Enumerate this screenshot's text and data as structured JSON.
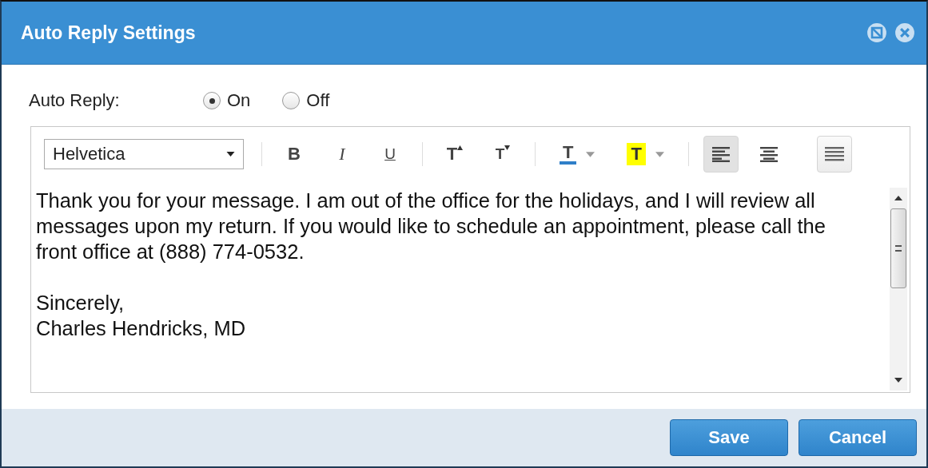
{
  "window": {
    "title": "Auto Reply Settings"
  },
  "auto_reply": {
    "label": "Auto Reply:",
    "options": [
      {
        "label": "On",
        "selected": true
      },
      {
        "label": "Off",
        "selected": false
      }
    ]
  },
  "toolbar": {
    "font": "Helvetica",
    "tools": [
      {
        "kind": "bold",
        "glyph": "B",
        "selected": false
      },
      {
        "kind": "italic",
        "glyph": "I",
        "selected": false
      },
      {
        "kind": "underline",
        "glyph": "U",
        "selected": false
      },
      {
        "kind": "separator"
      },
      {
        "kind": "grow",
        "glyph": "T",
        "selected": false
      },
      {
        "kind": "shrink",
        "glyph": "T",
        "selected": false
      },
      {
        "kind": "separator"
      },
      {
        "kind": "text-color",
        "glyph": "T",
        "color": "#2f7fc8"
      },
      {
        "kind": "highlight",
        "glyph": "T",
        "color": "#ffff00"
      },
      {
        "kind": "separator"
      },
      {
        "kind": "align-left",
        "selected": true
      },
      {
        "kind": "align-center",
        "selected": false
      },
      {
        "kind": "justify",
        "selected": false
      }
    ]
  },
  "message": {
    "paragraphs": [
      [
        "Thank you for your message. I am out of the office for the holidays, and I will review all messages upon my return. If you would like to schedule an appointment, please call the front office at (888) 774-0532."
      ],
      [
        "Sincerely,",
        "Charles Hendricks, MD"
      ]
    ]
  },
  "buttons": [
    "Save",
    "Cancel"
  ]
}
